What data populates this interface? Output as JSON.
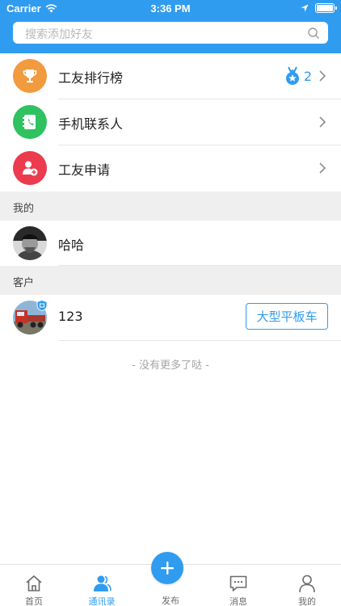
{
  "colors": {
    "primary": "#2f9cf0",
    "gold": "#f19a3e",
    "green": "#2ec261",
    "red": "#ec3b4e"
  },
  "status_bar": {
    "carrier": "Carrier",
    "time": "3:36 PM"
  },
  "search": {
    "placeholder": "搜索添加好友"
  },
  "menu": [
    {
      "label": "工友排行榜",
      "icon": "trophy-icon",
      "badge_count": "2"
    },
    {
      "label": "手机联系人",
      "icon": "phonebook-icon"
    },
    {
      "label": "工友申请",
      "icon": "add-user-icon"
    }
  ],
  "sections": {
    "mine": {
      "title": "我的",
      "contacts": [
        {
          "name": "哈哈",
          "avatar": "person-avatar"
        }
      ]
    },
    "customers": {
      "title": "客户",
      "contacts": [
        {
          "name": "123",
          "avatar": "truck-avatar",
          "tag": "大型平板车"
        }
      ]
    }
  },
  "no_more": "- 没有更多了哒 -",
  "tabs": [
    {
      "label": "首页",
      "icon": "home-icon",
      "active": false
    },
    {
      "label": "通讯录",
      "icon": "contacts-icon",
      "active": true
    },
    {
      "label": "发布",
      "icon": "plus-icon",
      "active": false
    },
    {
      "label": "消息",
      "icon": "message-icon",
      "active": false
    },
    {
      "label": "我的",
      "icon": "profile-icon",
      "active": false
    }
  ]
}
